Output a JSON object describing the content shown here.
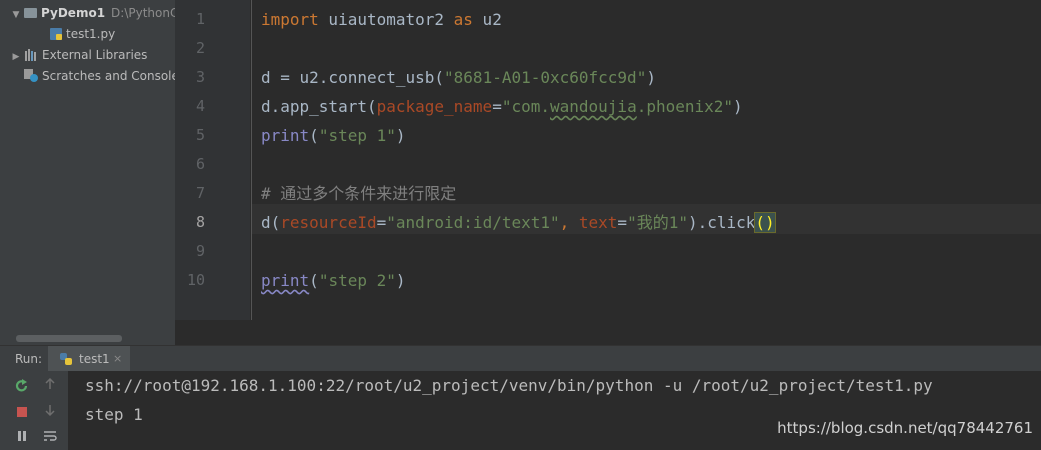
{
  "project": {
    "root_name": "PyDemo1",
    "root_path": "D:\\PythonC",
    "file": "test1.py",
    "external_libraries": "External Libraries",
    "scratches": "Scratches and Consoles"
  },
  "gutter": [
    "1",
    "2",
    "3",
    "4",
    "5",
    "6",
    "7",
    "8",
    "9",
    "10"
  ],
  "code": {
    "l1": {
      "kw1": "import",
      "mid": " uiautomator2 ",
      "kw2": "as",
      "end": " u2"
    },
    "l3": {
      "a": "d = u2.connect_usb(",
      "s": "\"8681-A01-0xc60fcc9d\"",
      "b": ")"
    },
    "l4": {
      "a": "d.app_start(",
      "p": "package_name",
      "eq": "=",
      "s1": "\"com.",
      "s2": "wandoujia",
      "s3": ".phoenix2\"",
      "b": ")"
    },
    "l5": {
      "fn": "print",
      "a": "(",
      "s": "\"step 1\"",
      "b": ")"
    },
    "l7": {
      "cm": "# 通过多个条件来进行限定"
    },
    "l8": {
      "a": "d(",
      "p1": "resourceId",
      "eq1": "=",
      "s1": "\"android:id/text1\"",
      "comma": ", ",
      "p2": "text",
      "eq2": "=",
      "s2": "\"我的1\"",
      "b": ").click",
      "br": "()"
    },
    "l10": {
      "fn": "print",
      "a": "(",
      "s": "\"step 2\"",
      "b": ")"
    }
  },
  "run": {
    "label": "Run:",
    "tab": "test1",
    "close": "×"
  },
  "console": {
    "line1": "ssh://root@192.168.1.100:22/root/u2_project/venv/bin/python -u /root/u2_project/test1.py",
    "line2": "step 1"
  },
  "watermark": "https://blog.csdn.net/qq78442761",
  "colors": {
    "keyword": "#cc7832",
    "string": "#6a8759",
    "param": "#aa4926",
    "comment": "#808080",
    "builtin": "#8888c6"
  },
  "icons": [
    "folder-icon",
    "python-file-icon",
    "library-icon",
    "scratches-icon",
    "rerun-icon",
    "stop-icon",
    "pause-icon",
    "up-arrow-icon",
    "down-arrow-icon",
    "soft-wrap-icon"
  ]
}
